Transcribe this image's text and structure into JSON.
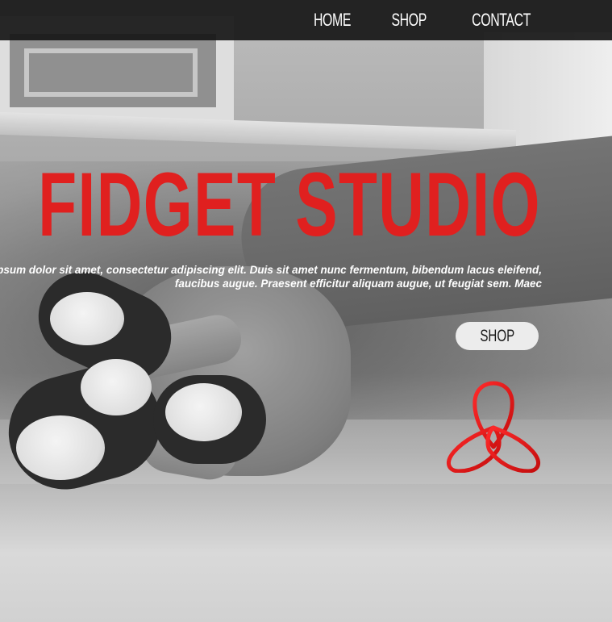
{
  "nav": {
    "items": [
      {
        "label": "HOME"
      },
      {
        "label": "SHOP"
      },
      {
        "label": "CONTACT"
      }
    ]
  },
  "hero": {
    "title": "FIDGET STUDIO",
    "paragraph": "Lorem ipsum dolor sit amet, consectetur adipiscing elit. Duis sit amet nunc fermentum, bibendum lacus eleifend, faucibus augue. Praesent efficitur aliquam augue, ut feugiat sem. Maec",
    "cta_label": "SHOP",
    "logo_icon": "fidget-spinner-logo-icon"
  },
  "colors": {
    "accent_red": "#e0201f",
    "nav_background": "#161616",
    "button_background": "#ececec"
  }
}
